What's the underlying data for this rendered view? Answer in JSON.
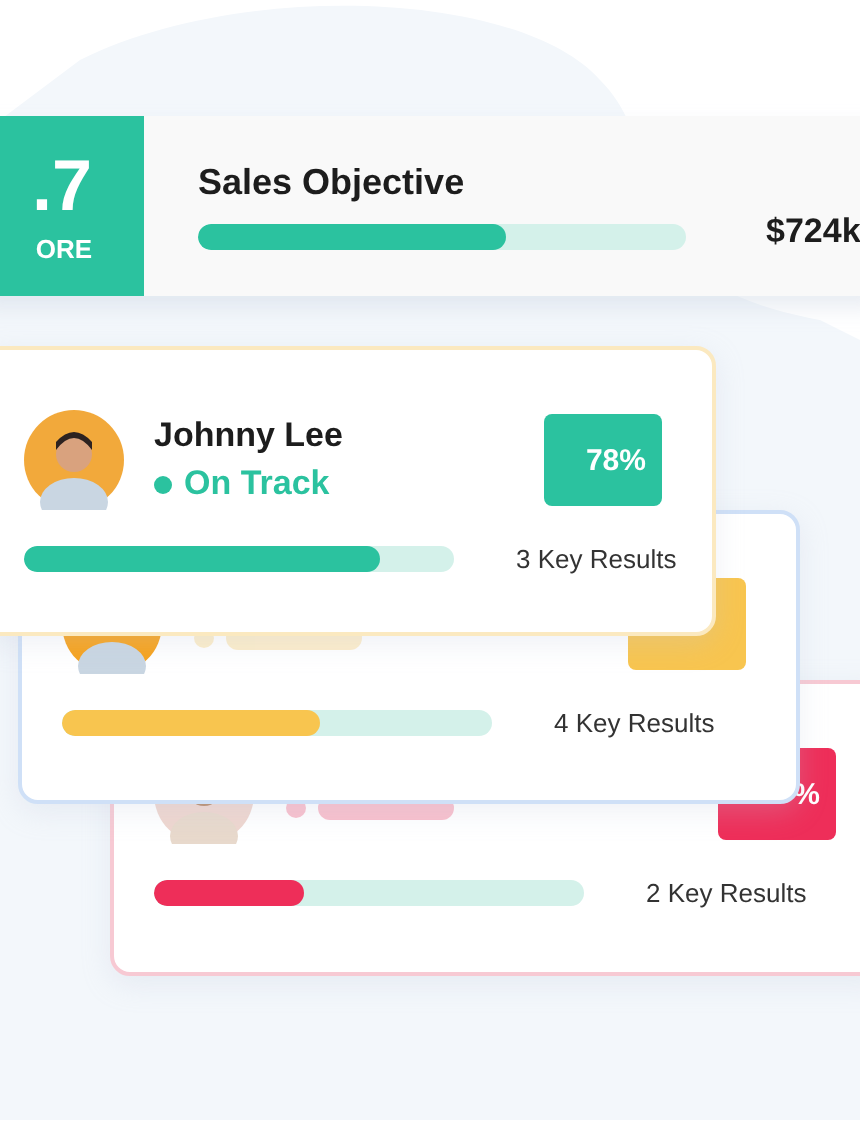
{
  "score": {
    "value": ".7",
    "label": "ORE"
  },
  "objective": {
    "title": "Sales Objective",
    "level": 0.63,
    "amount": "$724k"
  },
  "cards": [
    {
      "name": "Johnny Lee",
      "status": "On Track",
      "badge": "78%",
      "level": 0.83,
      "key_results": "3 Key Results",
      "color": "#2bc29f"
    },
    {
      "level": 0.6,
      "key_results": "4 Key Results",
      "color": "#f8c54f"
    },
    {
      "badge": "%",
      "level": 0.35,
      "key_results": "2 Key Results",
      "color": "#ee2e59"
    }
  ]
}
